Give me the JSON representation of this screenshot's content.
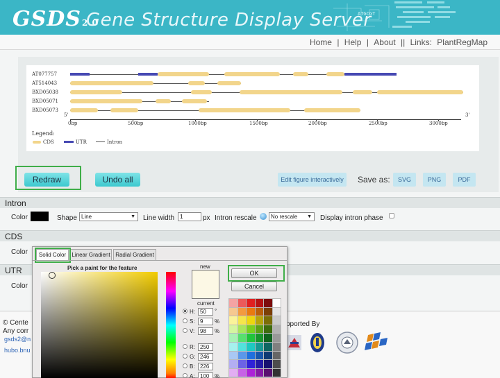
{
  "header": {
    "logo": "GSDS",
    "logo_version": "2.0",
    "title": "Gene Structure Display Server"
  },
  "nav": {
    "items": [
      "Home",
      "Help",
      "About"
    ],
    "links_label": "Links:",
    "links_item": "PlantRegMap",
    "sep": "|",
    "double_sep": "||"
  },
  "figure": {
    "genes": [
      "AT077757",
      "AT514043",
      "BXD05038",
      "BXD05071",
      "BXD05073"
    ],
    "ticks": [
      "0bp",
      "500bp",
      "1000bp",
      "1500bp",
      "2000bp",
      "2500bp",
      "3000bp"
    ],
    "five_prime": "5'",
    "three_prime": "3'",
    "legend_title": "Legend:",
    "legend_items": [
      "CDS",
      "UTR",
      "Intron"
    ],
    "colors": {
      "cds": "#f2d58b",
      "utr": "#4649b3",
      "intron": "#555555"
    }
  },
  "actions": {
    "redraw": "Redraw",
    "undo_all": "Undo all",
    "edit_interactive": "Edit figure interactively",
    "save_as": "Save as:",
    "svg": "SVG",
    "png": "PNG",
    "pdf": "PDF"
  },
  "intron": {
    "section_title": "Intron",
    "color_label": "Color",
    "shape_label": "Shape",
    "shape_value": "Line",
    "line_width_label": "Line width",
    "line_width_value": "1",
    "line_width_unit": "px",
    "rescale_label": "Intron rescale",
    "rescale_value": "No rescale",
    "phase_label": "Display intron phase"
  },
  "cds": {
    "section_title": "CDS",
    "color_label": "Color"
  },
  "utr": {
    "section_title": "UTR",
    "color_label": "Color"
  },
  "footer": {
    "copyright": "© Cente",
    "any_line": "Any corr",
    "email": "gsds2@n",
    "link": "hubo.bnu",
    "supported_by": "pported By"
  },
  "picker": {
    "tabs": [
      "Solid Color",
      "Linear Gradient",
      "Radial Gradient"
    ],
    "pick_title": "Pick a paint for the feature",
    "new_label": "new",
    "current_label": "current",
    "ok": "OK",
    "cancel": "Cancel",
    "fields": [
      {
        "label": "H:",
        "value": "50",
        "unit": "°"
      },
      {
        "label": "S:",
        "value": "9",
        "unit": "%"
      },
      {
        "label": "V:",
        "value": "98",
        "unit": "%"
      },
      {
        "label": "R:",
        "value": "250",
        "unit": ""
      },
      {
        "label": "G:",
        "value": "246",
        "unit": ""
      },
      {
        "label": "B:",
        "value": "226",
        "unit": ""
      },
      {
        "label": "A:",
        "value": "100",
        "unit": "%"
      }
    ],
    "selected_color": "#fcf8e5"
  }
}
